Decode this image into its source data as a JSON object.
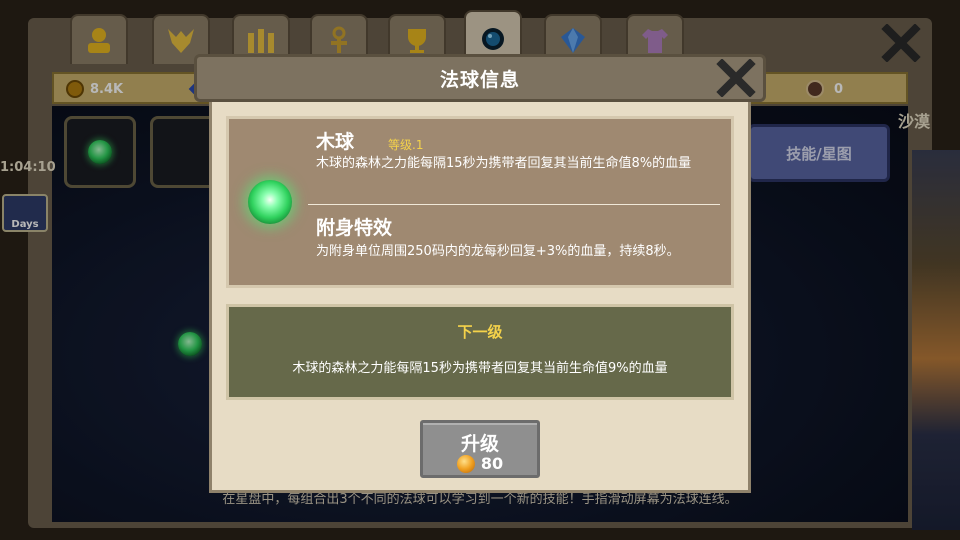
{
  "background": {
    "tabs": [
      {
        "icon": "gold-figure-icon"
      },
      {
        "icon": "dragon-head-icon"
      },
      {
        "icon": "castle-icon"
      },
      {
        "icon": "ankh-icon"
      },
      {
        "icon": "trophy-icon"
      },
      {
        "icon": "dark-orb-icon",
        "active": true
      },
      {
        "icon": "blue-gem-icon"
      },
      {
        "icon": "shirt-icon"
      }
    ],
    "resources": {
      "gold": "8.4K",
      "orb_count": "0"
    },
    "side_timer": "1:04:10",
    "day_badge": "Days",
    "skill_button": "技能/星图",
    "side_name": "沙漠",
    "footer_hint": "在星盘中，每组合出3个不同的法球可以学习到一个新的技能！手指滑动屏幕为法球连线。"
  },
  "modal": {
    "title": "法球信息",
    "orb": {
      "name": "木球",
      "level": "等级.1",
      "description": "木球的森林之力能每隔15秒为携带者回复其当前生命值8%的血量"
    },
    "attach": {
      "title": "附身特效",
      "description": "为附身单位周围250码内的龙每秒回复+3%的血量，持续8秒。"
    },
    "next_level": {
      "title": "下一级",
      "description": "木球的森林之力能每隔15秒为携带者回复其当前生命值9%的血量"
    },
    "upgrade": {
      "label": "升级",
      "cost": "80"
    }
  },
  "colors": {
    "modal_bg": "#e7dcc5",
    "info_box": "#9f8971",
    "next_box": "#66694a",
    "gold_text": "#f4d24a",
    "orb_green": "#30d25e"
  }
}
